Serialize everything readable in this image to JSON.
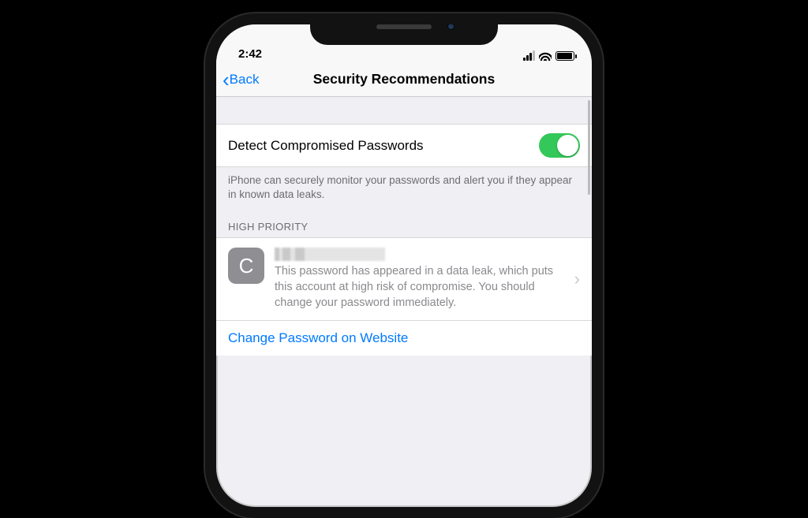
{
  "status": {
    "time": "2:42"
  },
  "nav": {
    "back_label": "Back",
    "title": "Security Recommendations"
  },
  "detect": {
    "label": "Detect Compromised Passwords",
    "enabled": true,
    "footer": "iPhone can securely monitor your passwords and alert you if they appear in known data leaks."
  },
  "section_header": "HIGH PRIORITY",
  "item": {
    "avatar_letter": "C",
    "subtitle": "This password has appeared in a data leak, which puts this account at high risk of compromise. You should change your password immediately."
  },
  "action": {
    "label": "Change Password on Website"
  }
}
